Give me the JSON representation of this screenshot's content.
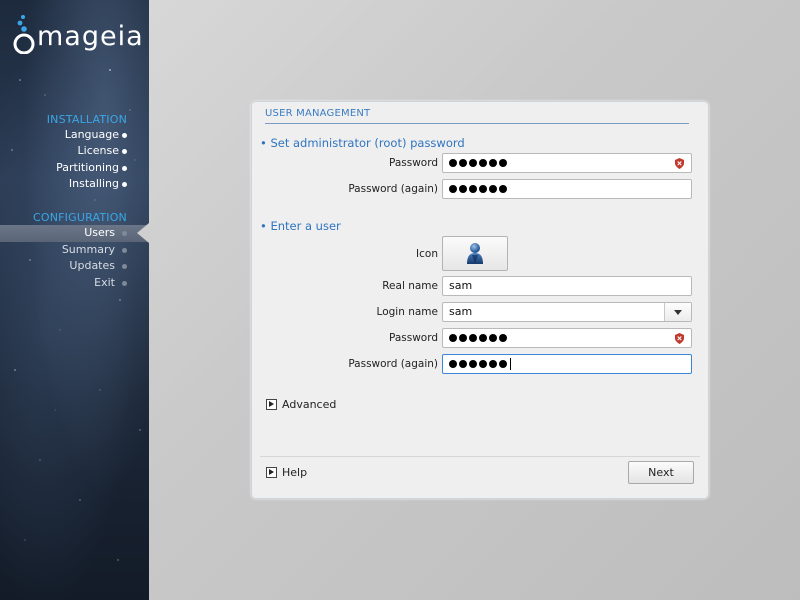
{
  "sidebar": {
    "logo_text": "mageia",
    "sections": [
      {
        "title": "INSTALLATION",
        "items": [
          {
            "label": "Language",
            "state": "done"
          },
          {
            "label": "License",
            "state": "done"
          },
          {
            "label": "Partitioning",
            "state": "done"
          },
          {
            "label": "Installing",
            "state": "done"
          }
        ]
      },
      {
        "title": "CONFIGURATION",
        "items": [
          {
            "label": "Users",
            "state": "active"
          },
          {
            "label": "Summary",
            "state": "pending"
          },
          {
            "label": "Updates",
            "state": "pending"
          },
          {
            "label": "Exit",
            "state": "pending"
          }
        ]
      }
    ]
  },
  "dialog": {
    "title": "USER MANAGEMENT",
    "root_section": {
      "heading": "• Set administrator (root) password",
      "password_label": "Password",
      "password_again_label": "Password (again)",
      "password_length": 6,
      "password_again_length": 6
    },
    "user_section": {
      "heading": "• Enter a user",
      "icon_label": "Icon",
      "real_name_label": "Real name",
      "real_name_value": "sam",
      "login_name_label": "Login name",
      "login_name_value": "sam",
      "password_label": "Password",
      "password_again_label": "Password (again)",
      "password_length": 6,
      "password_again_length": 6
    },
    "advanced_label": "Advanced",
    "help_label": "Help",
    "next_label": "Next"
  },
  "colors": {
    "accent": "#2f74c0",
    "sidebar_title": "#3aa6e8",
    "strength_icon": "#c0392b"
  }
}
